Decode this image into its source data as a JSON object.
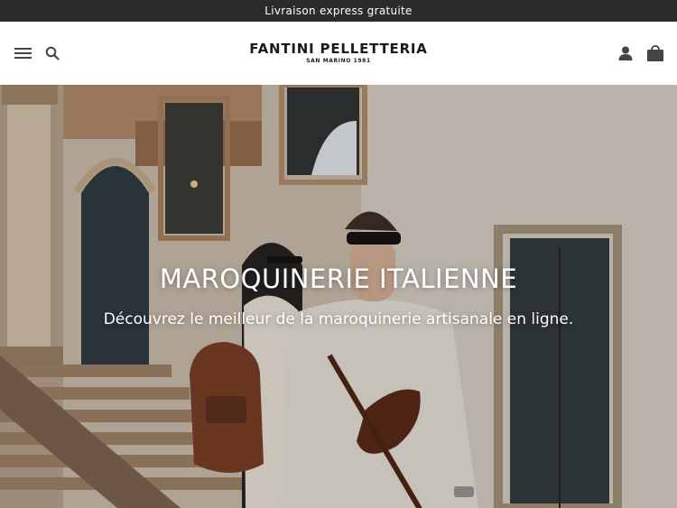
{
  "announcement": {
    "text": "Livraison express gratuite"
  },
  "header": {
    "logo_brand": "FANTINI PELLETTERIA",
    "logo_sub": "SAN MARINO 1981",
    "icons": [
      "menu-icon",
      "search-icon",
      "account-icon",
      "cart-icon"
    ]
  },
  "hero": {
    "title": "MAROQUINERIE ITALIENNE",
    "subtitle": "Découvrez le meilleur de la maroquinerie artisanale en ligne."
  },
  "colors": {
    "announce_bg": "#2b2b2b",
    "icon": "#444444",
    "text_dark": "#1a1a1a"
  }
}
